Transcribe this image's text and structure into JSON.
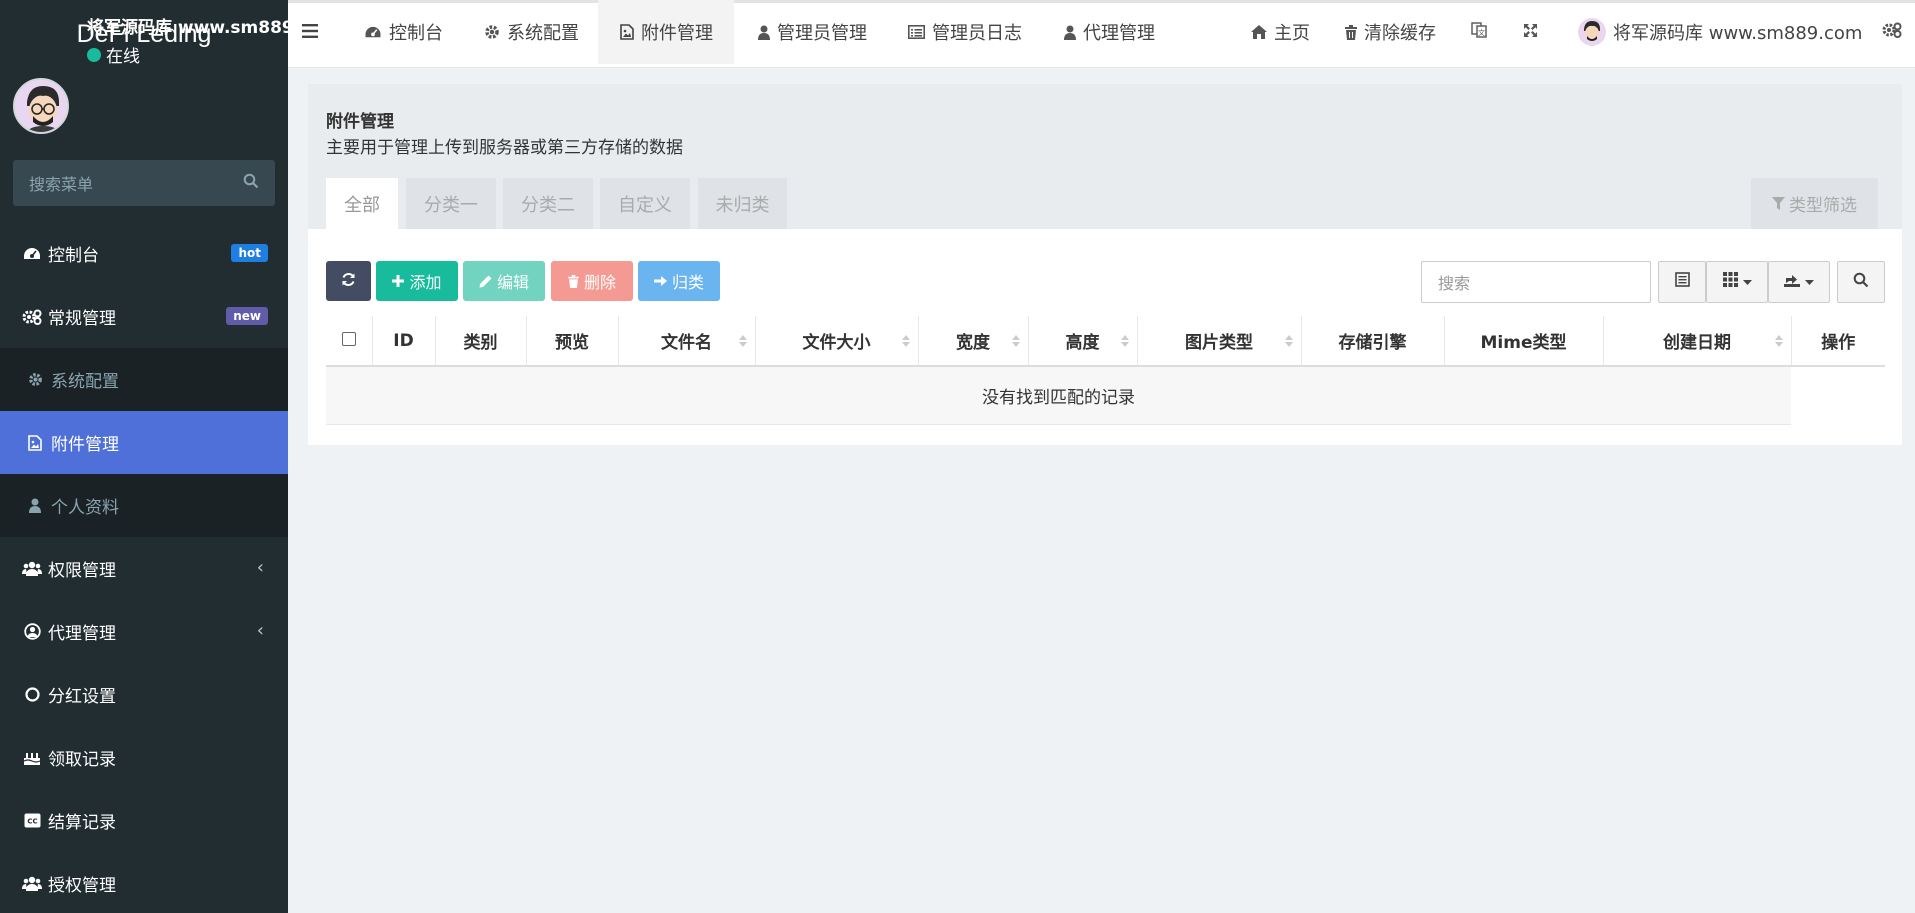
{
  "app": {
    "brand": "DeFi Leding"
  },
  "user": {
    "name": "将军源码库 www.sm889.com",
    "status": "在线"
  },
  "sidebar": {
    "search_placeholder": "搜索菜单",
    "items": [
      {
        "label": "控制台",
        "icon": "dashboard-icon",
        "badge": "hot"
      },
      {
        "label": "常规管理",
        "icon": "cogs-icon",
        "badge": "new"
      },
      {
        "label": "系统配置",
        "icon": "gear-icon"
      },
      {
        "label": "附件管理",
        "icon": "image-file-icon"
      },
      {
        "label": "个人资料",
        "icon": "user-icon"
      },
      {
        "label": "权限管理",
        "icon": "group-icon"
      },
      {
        "label": "代理管理",
        "icon": "user-circle-icon"
      },
      {
        "label": "分红设置",
        "icon": "circle-icon"
      },
      {
        "label": "领取记录",
        "icon": "birthday-cake-icon"
      },
      {
        "label": "结算记录",
        "icon": "cc-icon"
      },
      {
        "label": "授权管理",
        "icon": "group-icon"
      }
    ]
  },
  "topnav": {
    "tabs": [
      {
        "label": "控制台",
        "icon": "dashboard-icon"
      },
      {
        "label": "系统配置",
        "icon": "gear-icon"
      },
      {
        "label": "附件管理",
        "icon": "image-file-icon",
        "active": true
      },
      {
        "label": "管理员管理",
        "icon": "user-icon"
      },
      {
        "label": "管理员日志",
        "icon": "list-alt-icon"
      },
      {
        "label": "代理管理",
        "icon": "user-icon"
      }
    ],
    "home": "主页",
    "clear_cache": "清除缓存",
    "user_name": "将军源码库 www.sm889.com"
  },
  "page": {
    "title": "附件管理",
    "description": "主要用于管理上传到服务器或第三方存储的数据",
    "tabs": [
      "全部",
      "分类一",
      "分类二",
      "自定义",
      "未归类"
    ],
    "filter_label": "类型筛选"
  },
  "toolbar": {
    "add": "添加",
    "edit": "编辑",
    "delete": "删除",
    "classify": "归类",
    "search_placeholder": "搜索"
  },
  "table": {
    "columns": [
      "ID",
      "类别",
      "预览",
      "文件名",
      "文件大小",
      "宽度",
      "高度",
      "图片类型",
      "存储引擎",
      "Mime类型",
      "创建日期",
      "操作"
    ],
    "empty_text": "没有找到匹配的记录"
  },
  "colors": {
    "sidebar_bg": "#222d32",
    "active_menu": "#4f6fd9",
    "add": "#18bc9c",
    "edit": "#72d4c0",
    "delete": "#f59a92",
    "classify": "#6ab4f0",
    "refresh": "#444c63"
  }
}
